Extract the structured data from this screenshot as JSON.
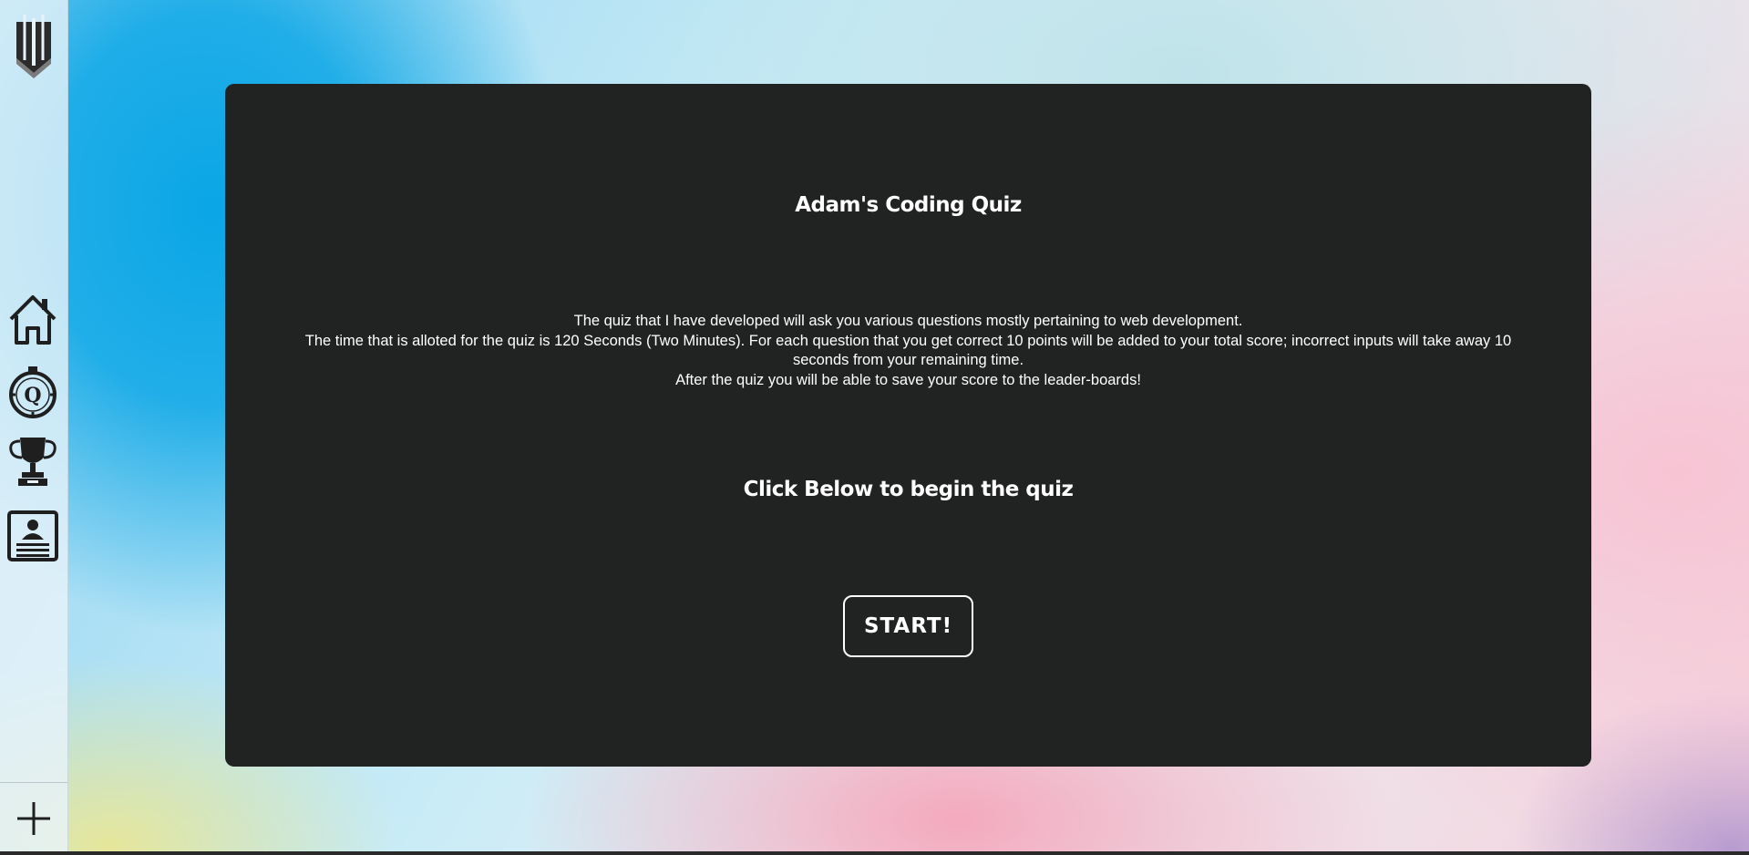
{
  "sidebar": {
    "logo_icon": "shield-logo-icon",
    "nav": [
      {
        "name": "home",
        "icon": "home-icon"
      },
      {
        "name": "quiz",
        "icon": "stopwatch-q-icon"
      },
      {
        "name": "highscores",
        "icon": "trophy-icon"
      },
      {
        "name": "profile",
        "icon": "profile-card-icon"
      }
    ],
    "add_icon": "plus-icon"
  },
  "quiz": {
    "title": "Adam's Coding Quiz",
    "description": [
      "The quiz that I have developed will ask you various questions mostly pertaining to web development.",
      "The time that is alloted for the quiz is 120 Seconds (Two Minutes). For each question that you get correct 10 points will be added to your total score; incorrect inputs will take away 10 seconds from your remaining time.",
      "After the quiz you will be able to save your score to the leader-boards!"
    ],
    "cta": "Click Below to begin the quiz",
    "start_label": "START!"
  },
  "colors": {
    "card_background": "#212322",
    "text": "#ffffff",
    "sidebar_icon": "#1f1f1f"
  }
}
